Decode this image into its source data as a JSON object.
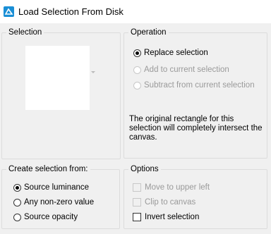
{
  "window": {
    "title": "Load Selection From Disk",
    "icon": "selection-app-icon"
  },
  "selection_group": {
    "label": "Selection"
  },
  "operation_group": {
    "label": "Operation",
    "options": [
      {
        "label": "Replace selection",
        "selected": true,
        "enabled": true
      },
      {
        "label": "Add to current selection",
        "selected": false,
        "enabled": false
      },
      {
        "label": "Subtract from current selection",
        "selected": false,
        "enabled": false
      }
    ],
    "info_text": "The original rectangle for this selection will completely intersect the canvas."
  },
  "create_group": {
    "label": "Create selection from:",
    "options": [
      {
        "label": "Source luminance",
        "selected": true
      },
      {
        "label": "Any non-zero value",
        "selected": false
      },
      {
        "label": "Source opacity",
        "selected": false
      }
    ]
  },
  "options_group": {
    "label": "Options",
    "items": [
      {
        "label": "Move to upper left",
        "checked": false,
        "enabled": false
      },
      {
        "label": "Clip to canvas",
        "checked": false,
        "enabled": false
      },
      {
        "label": "Invert selection",
        "checked": false,
        "enabled": true
      }
    ]
  },
  "colors": {
    "accent": "#1a8fd6",
    "window_bg": "#f0f0f0",
    "group_border": "#dcdcdc",
    "disabled_text": "#9a9a9a"
  }
}
